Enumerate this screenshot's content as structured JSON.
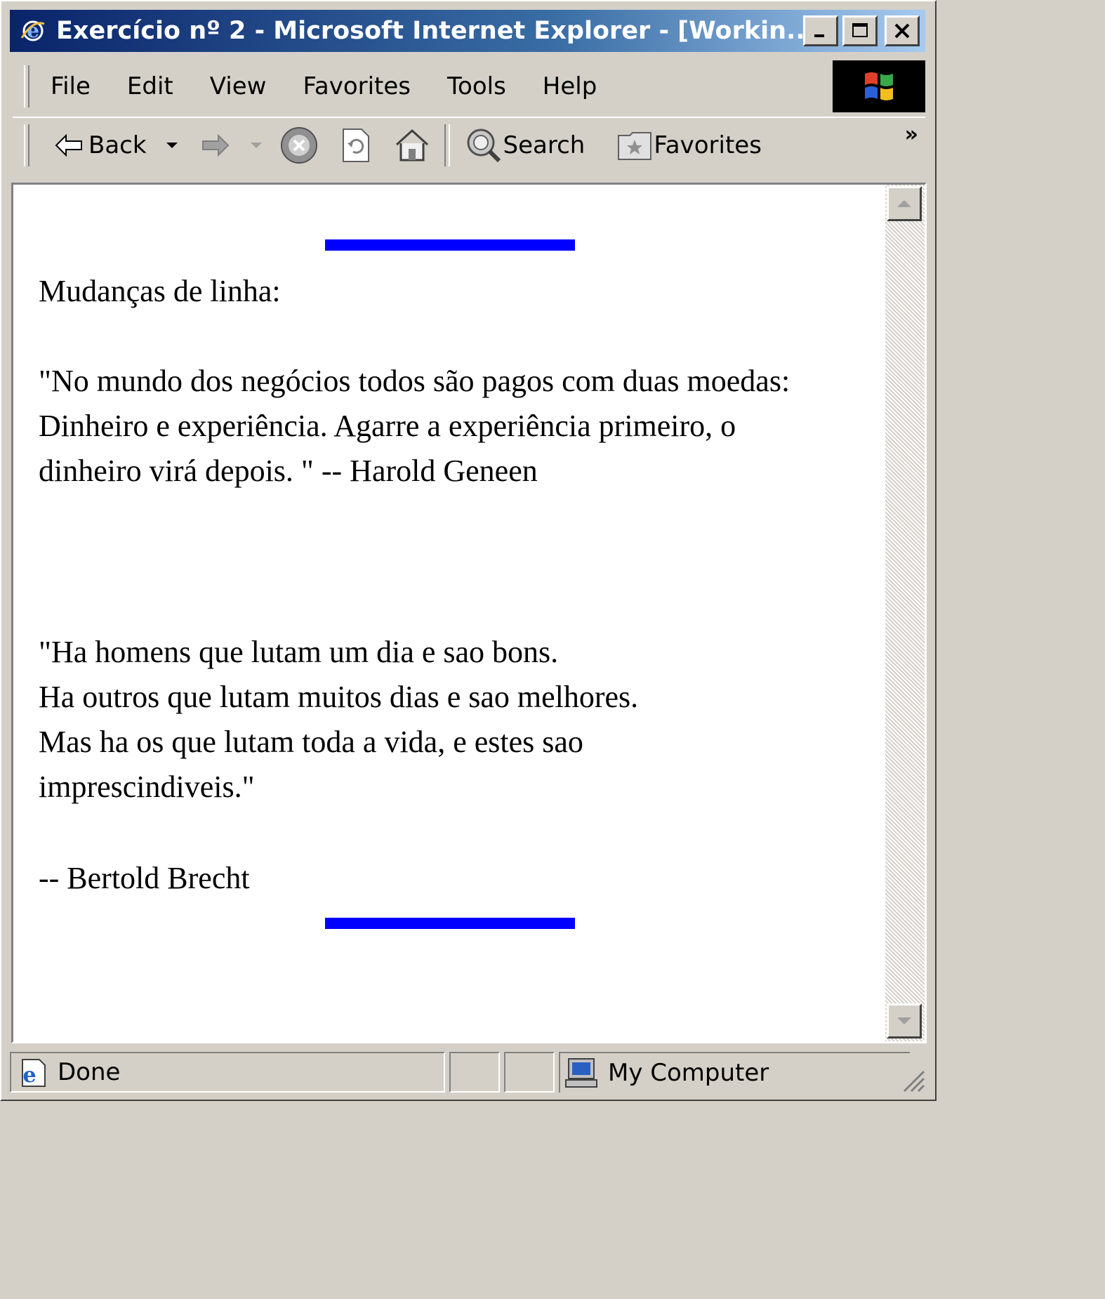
{
  "window": {
    "title": "Exercício nº 2 - Microsoft Internet Explorer - [Workin..."
  },
  "menu": {
    "items": [
      {
        "label": "File",
        "key": "file"
      },
      {
        "label": "Edit",
        "key": "edit"
      },
      {
        "label": "View",
        "key": "view"
      },
      {
        "label": "Favorites",
        "key": "favorites"
      },
      {
        "label": "Tools",
        "key": "tools"
      },
      {
        "label": "Help",
        "key": "help"
      }
    ]
  },
  "toolbar": {
    "back_label": "Back",
    "search_label": "Search",
    "favorites_label": "Favorites",
    "more": "»"
  },
  "page": {
    "heading": "Mudanças de linha:",
    "quote1": "\"No mundo dos negócios todos são pagos com duas moedas: Dinheiro e experiência. Agarre a experiência primeiro, o dinheiro virá depois. \" -- Harold Geneen",
    "quote2_lines": [
      "\"Ha homens que lutam um dia e sao bons.",
      "Ha outros que lutam muitos dias e sao melhores.",
      "Mas ha os que lutam toda a vida, e estes sao",
      "imprescindiveis.\""
    ],
    "attribution": "-- Bertold Brecht",
    "rule_color": "#0000ff"
  },
  "status": {
    "text": "Done",
    "zone": "My Computer"
  }
}
